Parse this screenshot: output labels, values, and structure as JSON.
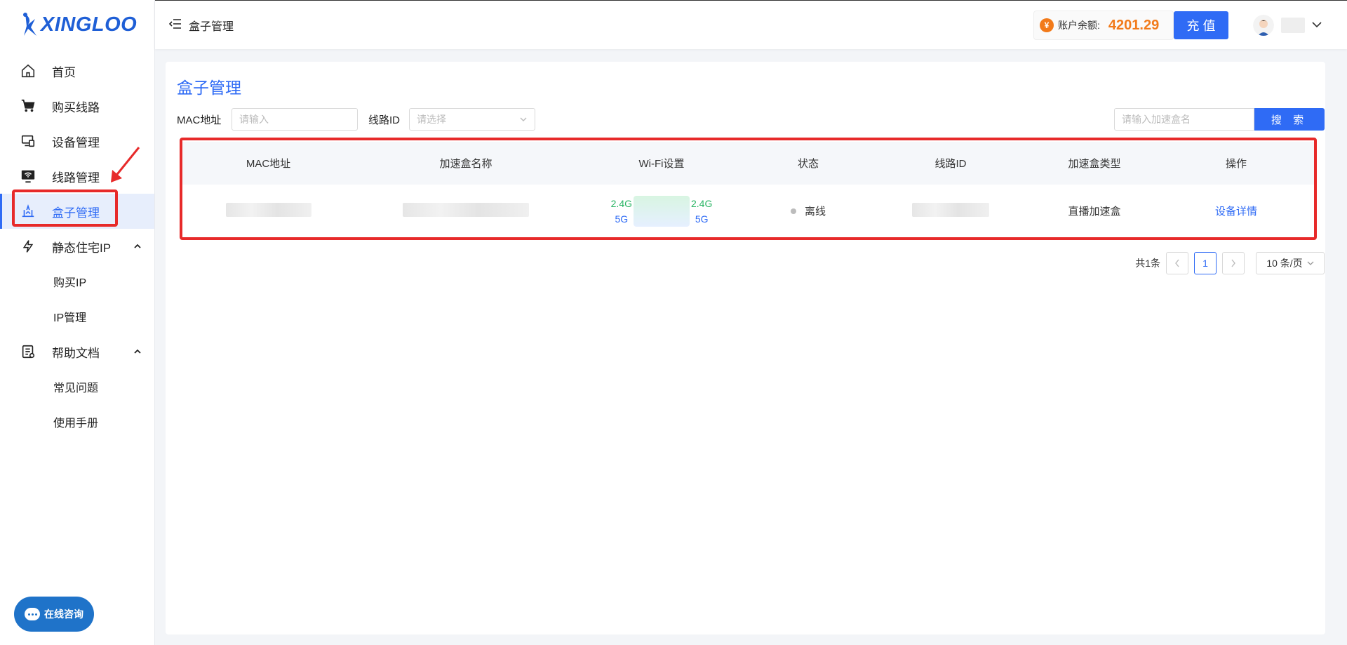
{
  "brand": {
    "name": "XINGLOO"
  },
  "sidebar": {
    "items": [
      {
        "label": "首页",
        "icon": "home-icon"
      },
      {
        "label": "购买线路",
        "icon": "cart-icon"
      },
      {
        "label": "设备管理",
        "icon": "device-icon"
      },
      {
        "label": "线路管理",
        "icon": "monitor-icon"
      },
      {
        "label": "盒子管理",
        "icon": "router-icon",
        "active": true
      },
      {
        "label": "静态住宅IP",
        "icon": "lightning-icon",
        "expanded": true
      },
      {
        "label": "帮助文档",
        "icon": "doc-icon",
        "expanded": true
      }
    ],
    "sub_static_ip": [
      "购买IP",
      "IP管理"
    ],
    "sub_help": [
      "常见问题",
      "使用手册"
    ]
  },
  "chat": {
    "label": "在线咨询"
  },
  "header": {
    "breadcrumb": "盒子管理",
    "balance_label": "账户余额:",
    "balance_value": "4201.29",
    "recharge_label": "充 值"
  },
  "page": {
    "title": "盒子管理",
    "filters": {
      "mac_label": "MAC地址",
      "mac_placeholder": "请输入",
      "line_label": "线路ID",
      "line_placeholder": "请选择",
      "name_placeholder": "请输入加速盒名",
      "search_label": "搜 索"
    },
    "table": {
      "headers": [
        "MAC地址",
        "加速盒名称",
        "Wi-Fi设置",
        "状态",
        "线路ID",
        "加速盒类型",
        "操作"
      ],
      "rows": [
        {
          "wifi_24_left": "2.4G",
          "wifi_5_left": "5G",
          "wifi_24_right": "2.4G",
          "wifi_5_right": "5G",
          "status": "离线",
          "type": "直播加速盒",
          "action": "设备详情"
        }
      ]
    },
    "pagination": {
      "total": "共1条",
      "current": "1",
      "page_size": "10 条/页"
    }
  },
  "colors": {
    "accent": "#2f6bf5",
    "balance": "#f27a1a",
    "highlight": "#e72a2a",
    "wifi_24": "#28b463"
  }
}
